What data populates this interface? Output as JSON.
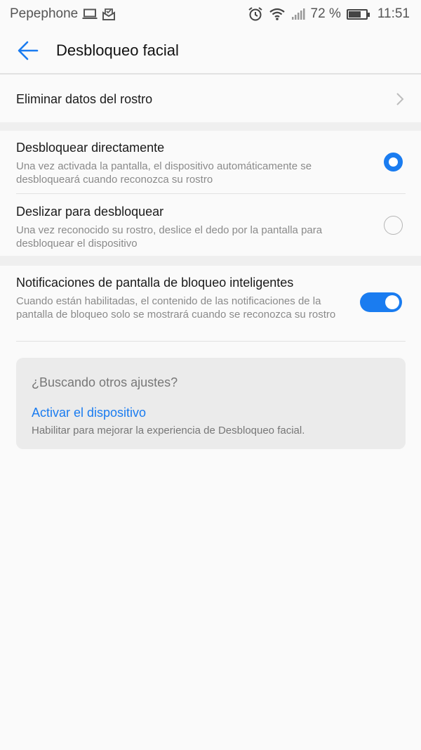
{
  "status_bar": {
    "carrier": "Pepephone",
    "battery_percent": "72 %",
    "battery_level": 0.72,
    "time": "11:51",
    "icons": [
      "laptop-icon",
      "mail-icon",
      "alarm-icon",
      "wifi-icon",
      "signal-icon",
      "battery-icon"
    ]
  },
  "header": {
    "title": "Desbloqueo facial"
  },
  "delete_row": {
    "label": "Eliminar datos del rostro"
  },
  "options": [
    {
      "title": "Desbloquear directamente",
      "description": "Una vez activada la pantalla, el dispositivo automáticamente se desbloqueará cuando reconozca su rostro",
      "selected": true
    },
    {
      "title": "Deslizar para desbloquear",
      "description": "Una vez reconocido su rostro, deslice el dedo por la pantalla para desbloquear el dispositivo",
      "selected": false
    }
  ],
  "smart_notifications": {
    "title": "Notificaciones de pantalla de bloqueo inteligentes",
    "description": "Cuando están habilitadas, el contenido de las notificaciones de la pantalla de bloqueo solo se mostrará cuando se reconozca su rostro",
    "enabled": true
  },
  "suggestion_card": {
    "title": "¿Buscando otros ajustes?",
    "link": "Activar el dispositivo",
    "description": "Habilitar para mejorar la experiencia de Desbloqueo facial."
  },
  "colors": {
    "accent": "#1a7cf0",
    "background": "#fafafa",
    "card_background": "#ebebeb"
  }
}
